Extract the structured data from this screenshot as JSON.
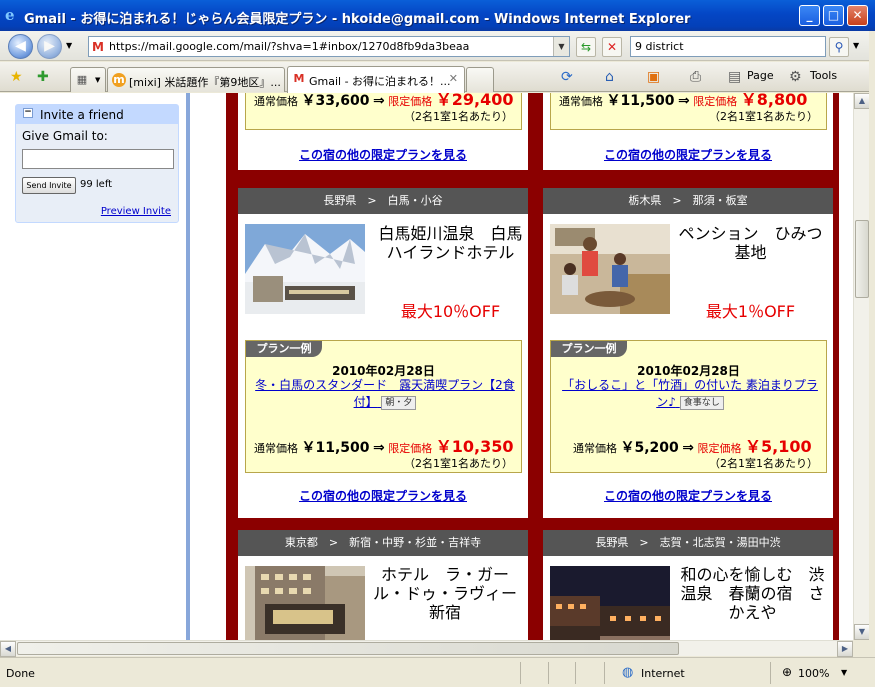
{
  "window": {
    "title": "Gmail - お得に泊まれる！じゃらん会員限定プラン - hkoide@gmail.com - Windows Internet Explorer",
    "minimize": "_",
    "maximize": "□",
    "close": "✕"
  },
  "address": {
    "url": "https://mail.google.com/mail/?shva=1#inbox/1270d8fb9da3beaa",
    "search_value": "9 district"
  },
  "tabs": [
    {
      "label": "[mixi] 米話題作『第9地区』...",
      "icon": "mixi-icon"
    },
    {
      "label": "Gmail - お得に泊まれる！...",
      "icon": "gmail-icon"
    }
  ],
  "commands": {
    "page": "Page",
    "tools": "Tools"
  },
  "invite": {
    "title": "Invite a friend",
    "give_label": "Give Gmail to:",
    "input_value": "",
    "send_label": "Send Invite",
    "left_text": "99 left",
    "preview_label": "Preview Invite"
  },
  "top_cards": [
    {
      "regular_label": "通常価格",
      "regular_price": "￥33,600",
      "arrow": "⇒",
      "limited_label": "限定価格",
      "limited_price": "￥29,400",
      "note": "（2名1室1名あたり）",
      "more": "この宿の他の限定プランを見る"
    },
    {
      "regular_label": "通常価格",
      "regular_price": "￥11,500",
      "arrow": "⇒",
      "limited_label": "限定価格",
      "limited_price": "￥8,800",
      "note": "（2名1室1名あたり）",
      "more": "この宿の他の限定プランを見る"
    }
  ],
  "cards": [
    {
      "area": "長野県　>　白馬・小谷",
      "name": "白馬姫川温泉　白馬ハイランドホテル",
      "discount": "最大10％OFF",
      "plan_tag": "プラン一例",
      "date": "2010年02月28日",
      "plan_title": "冬・白馬のスタンダード　露天満喫プラン【2食付】",
      "meal": "朝・夕",
      "regular_label": "通常価格",
      "regular_price": "￥11,500",
      "arrow": "⇒",
      "limited_label": "限定価格",
      "limited_price": "￥10,350",
      "note": "（2名1室1名あたり）",
      "more": "この宿の他の限定プランを見る"
    },
    {
      "area": "栃木県　>　那須・板室",
      "name": "ペンション　ひみつ基地",
      "discount": "最大1％OFF",
      "plan_tag": "プラン一例",
      "date": "2010年02月28日",
      "plan_title": "「おしるこ」と「竹酒」の付いた 素泊まりプラン♪",
      "meal": "食事なし",
      "regular_label": "通常価格",
      "regular_price": "￥5,200",
      "arrow": "⇒",
      "limited_label": "限定価格",
      "limited_price": "￥5,100",
      "note": "（2名1室1名あたり）",
      "more": "この宿の他の限定プランを見る"
    },
    {
      "area": "東京都　>　新宿・中野・杉並・吉祥寺",
      "name": "ホテル　ラ・ガール・ドゥ・ラヴィー新宿"
    },
    {
      "area": "長野県　>　志賀・北志賀・湯田中渋",
      "name": "和の心を愉しむ　渋温泉　春蘭の宿　さかえや"
    }
  ],
  "status": {
    "text": "Done",
    "zone": "Internet",
    "zoom": "100%"
  },
  "colors": {
    "frame": "#8b0000",
    "discount": "#e60000",
    "link": "#0000cc",
    "plan_bg": "#ffffcc"
  }
}
